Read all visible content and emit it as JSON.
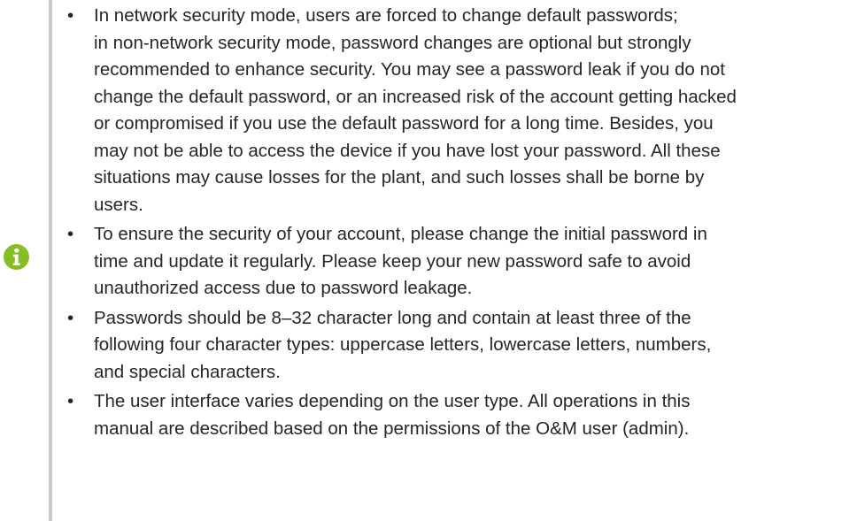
{
  "note": {
    "icon": "info-icon",
    "icon_color": "#86bd25",
    "rule_color": "#c9c9c9",
    "bullet": "•",
    "items": [
      {
        "lines": [
          "In network security mode, users are forced to change default passwords;",
          "in non-network security mode, password changes are optional but strongly",
          "recommended to enhance security. You may see a password leak if you do not",
          "change the default password, or an increased risk of the account getting hacked",
          "or compromised if you use the default password for a long time. Besides, you",
          "may not be able to access the device if you have lost your password. All these",
          "situations may cause losses for the plant, and such losses shall be borne by",
          "users."
        ]
      },
      {
        "lines": [
          "To ensure the security of your account, please change the initial password in",
          "time and update it regularly. Please keep your new password safe to avoid",
          "unauthorized access due to password leakage."
        ]
      },
      {
        "lines": [
          "Passwords should be 8–32 character long and contain at least three of the",
          "following four character types: uppercase letters, lowercase letters, numbers,",
          "and special characters."
        ]
      },
      {
        "lines": [
          "The user interface varies depending on the user type. All operations in this",
          "manual are described based on the permissions of the O&M user (admin)."
        ]
      }
    ]
  }
}
